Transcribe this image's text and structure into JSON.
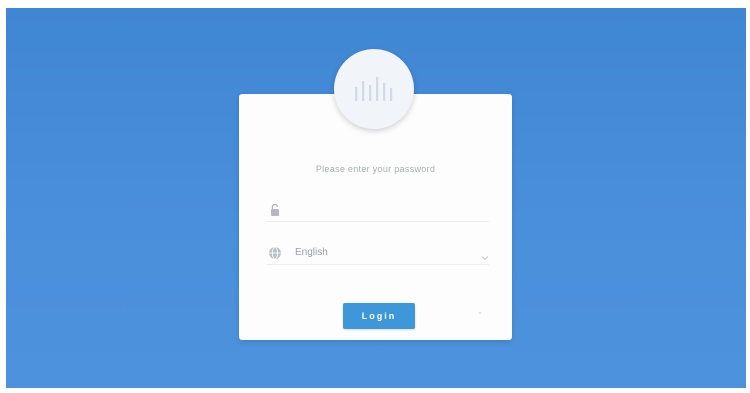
{
  "login": {
    "prompt": "Please enter your password",
    "password": {
      "value": "",
      "placeholder": "",
      "icon": "lock-icon"
    },
    "language": {
      "selected": "English",
      "icon": "globe-icon",
      "dropdown_icon": "chevron-down-icon"
    },
    "submit_label": "Login"
  },
  "colors": {
    "background": "#4a8fdb",
    "card": "#fdfdfd",
    "accent": "#3d97d8",
    "muted_text": "#a9aeb6"
  }
}
